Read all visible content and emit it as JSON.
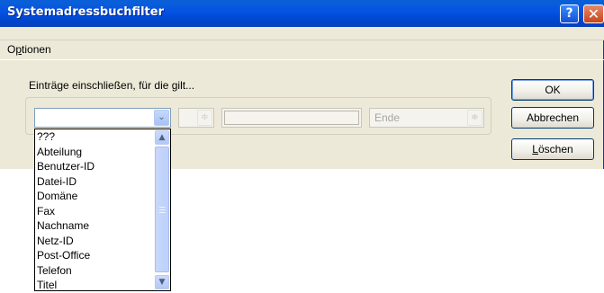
{
  "window": {
    "title": "Systemadressbuchfilter",
    "help_glyph": "?",
    "close_glyph": "✕"
  },
  "menu": {
    "options_prefix": "O",
    "options_underlined": "p",
    "options_suffix": "tionen"
  },
  "filter": {
    "section_label": "Einträge einschließen, für die gilt...",
    "field_value": "",
    "operator_value": "",
    "value_text": "",
    "end_value": "Ende",
    "arrow_down": "⌄",
    "spin_arrows": "≑"
  },
  "buttons": {
    "ok": "OK",
    "cancel": "Abbrechen",
    "delete_underlined": "L",
    "delete_rest": "öschen"
  },
  "dropdown": {
    "items": [
      "???",
      "Abteilung",
      "Benutzer-ID",
      "Datei-ID",
      "Domäne",
      "Fax",
      "Nachname",
      "Netz-ID",
      "Post-Office",
      "Telefon",
      "Titel"
    ],
    "scroll_up_glyph": "▲",
    "scroll_down_glyph": "▼"
  },
  "colors": {
    "titlebar": "#0553e4",
    "dialog_background": "#ece9d8",
    "close_button": "#c5471c"
  }
}
